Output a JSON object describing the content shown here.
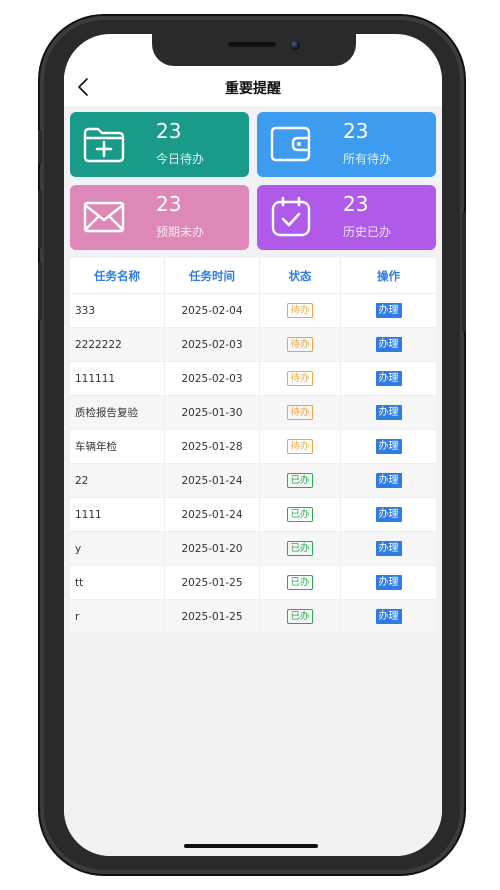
{
  "header": {
    "title": "重要提醒"
  },
  "colors": {
    "teal": "#1a9a89",
    "blue": "#3d9cf0",
    "pink": "#de88b8",
    "purple": "#b05ae9",
    "accent": "#2f7de1",
    "pending": "#f5a43c",
    "done": "#22b04a"
  },
  "cards": [
    {
      "icon": "folder-plus-icon",
      "count": "23",
      "label": "今日待办"
    },
    {
      "icon": "wallet-icon",
      "count": "23",
      "label": "所有待办"
    },
    {
      "icon": "mail-icon",
      "count": "23",
      "label": "预期未办"
    },
    {
      "icon": "calendar-check-icon",
      "count": "23",
      "label": "历史已办"
    }
  ],
  "table": {
    "headers": [
      "任务名称",
      "任务时间",
      "状态",
      "操作"
    ],
    "rows": [
      {
        "name": "333",
        "date": "2025-02-04",
        "status": "待办",
        "action": "办理"
      },
      {
        "name": "2222222",
        "date": "2025-02-03",
        "status": "待办",
        "action": "办理"
      },
      {
        "name": "111111",
        "date": "2025-02-03",
        "status": "待办",
        "action": "办理"
      },
      {
        "name": "质检报告复验",
        "date": "2025-01-30",
        "status": "待办",
        "action": "办理"
      },
      {
        "name": "车辆年检",
        "date": "2025-01-28",
        "status": "待办",
        "action": "办理"
      },
      {
        "name": "22",
        "date": "2025-01-24",
        "status": "已办",
        "action": "办理"
      },
      {
        "name": "1111",
        "date": "2025-01-24",
        "status": "已办",
        "action": "办理"
      },
      {
        "name": "y",
        "date": "2025-01-20",
        "status": "已办",
        "action": "办理"
      },
      {
        "name": "tt",
        "date": "2025-01-25",
        "status": "已办",
        "action": "办理"
      },
      {
        "name": "r",
        "date": "2025-01-25",
        "status": "已办",
        "action": "办理"
      }
    ]
  }
}
